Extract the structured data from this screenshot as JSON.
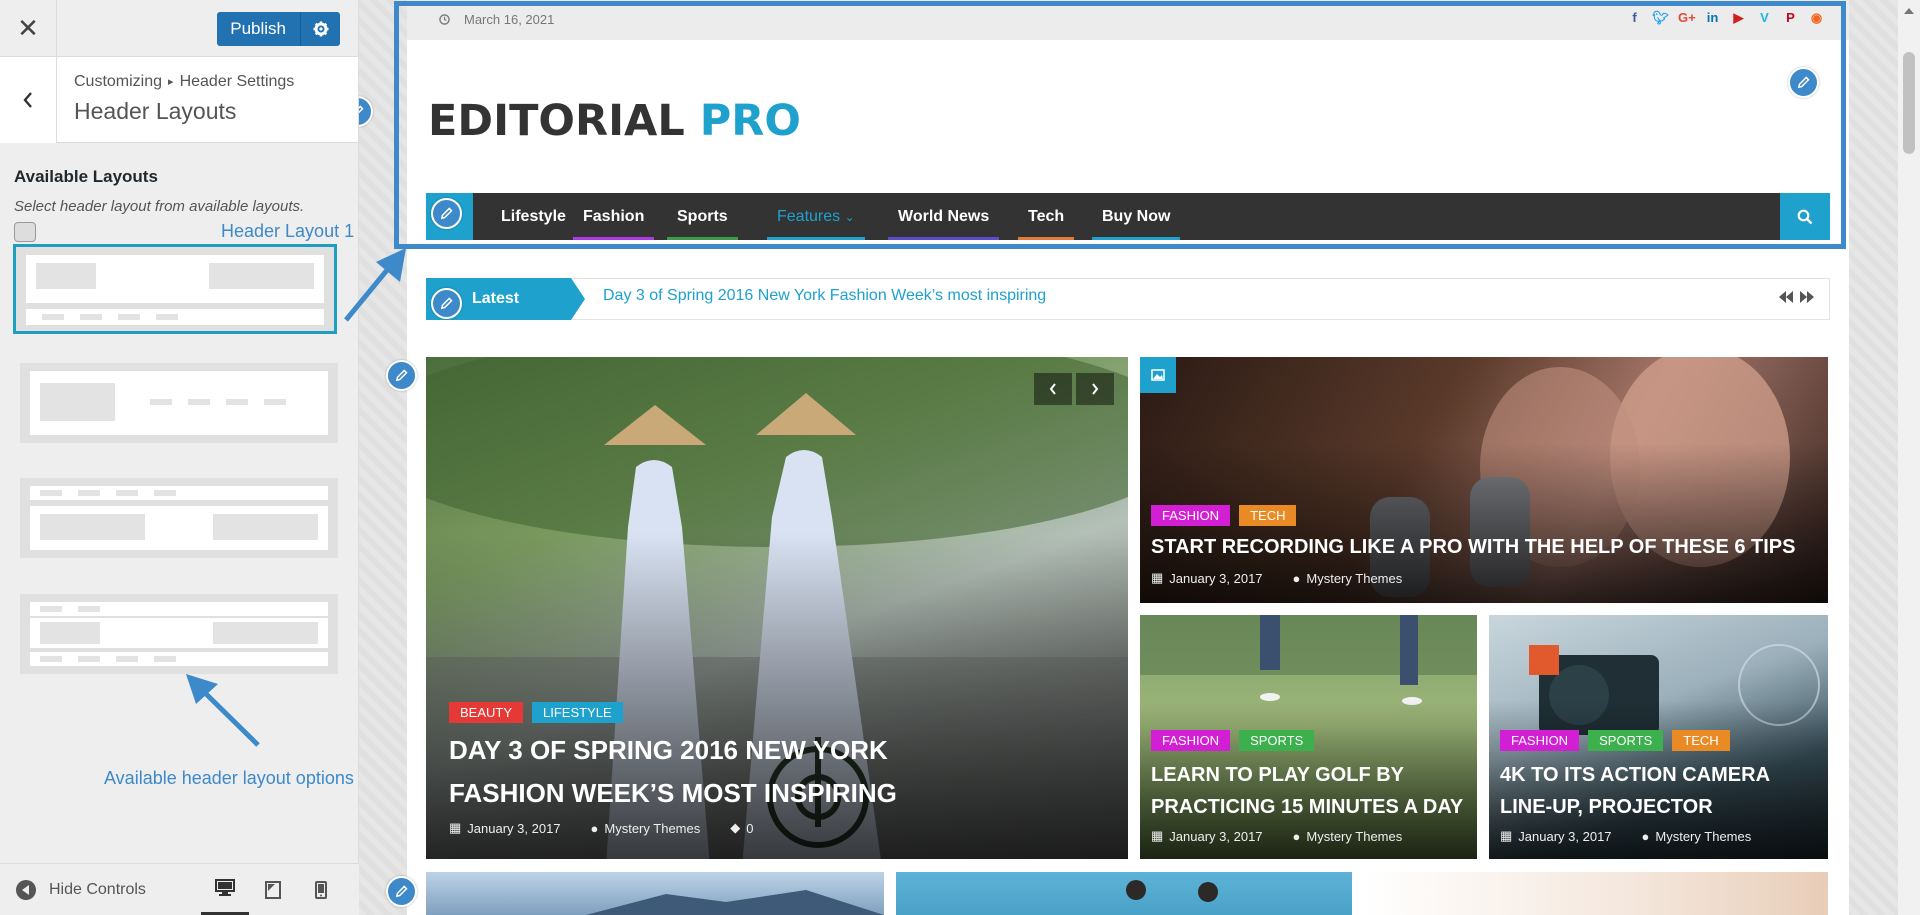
{
  "customizer": {
    "publish_label": "Publish",
    "breadcrumb_root": "Customizing",
    "breadcrumb_sep": "▸",
    "breadcrumb_section": "Header Settings",
    "section_title": "Header Layouts",
    "control_title": "Available Layouts",
    "control_desc": "Select header layout from available layouts.",
    "callout_selected": "Header Layout 1",
    "callout_options": "Available header layout options",
    "hide_controls": "Hide Controls",
    "colors": {
      "primary": "#2271b1",
      "accent": "#3d89c9",
      "selected_outline": "#1e9ec1"
    }
  },
  "site": {
    "date": "March 16, 2021",
    "logo_main": "EDITORIAL",
    "logo_accent": "PRO",
    "social_icons": [
      "facebook-icon",
      "twitter-icon",
      "google-plus-icon",
      "linkedin-icon",
      "youtube-icon",
      "vimeo-icon",
      "pinterest-icon",
      "rss-icon"
    ],
    "nav": [
      {
        "label": "Lifestyle",
        "bar": ""
      },
      {
        "label": "Fashion",
        "bar": "#a83be3"
      },
      {
        "label": "Sports",
        "bar": "#3d9b48"
      },
      {
        "label": "Features",
        "bar": "#1ea1cd",
        "active": true
      },
      {
        "label": "World News",
        "bar": "#5b4ec9"
      },
      {
        "label": "Tech",
        "bar": "#e07b39"
      },
      {
        "label": "Buy Now",
        "bar": "#1ea1cd"
      }
    ],
    "ticker_label": "Latest",
    "ticker_text": "Day 3 of Spring 2016 New York Fashion Week’s most inspiring",
    "colors": {
      "brand": "#1ea1cd",
      "nav_bg": "#333333"
    },
    "posts": {
      "main": {
        "cats": [
          "BEAUTY",
          "LIFESTYLE"
        ],
        "title": "DAY 3 OF SPRING 2016 NEW YORK FASHION WEEK’S MOST INSPIRING",
        "date": "January 3, 2017",
        "author": "Mystery Themes",
        "comments": "0"
      },
      "top_right": {
        "cats": [
          "FASHION",
          "TECH"
        ],
        "title": "START RECORDING LIKE A PRO WITH THE HELP OF THESE 6 TIPS",
        "date": "January 3, 2017",
        "author": "Mystery Themes"
      },
      "bottom_left": {
        "cats": [
          "FASHION",
          "SPORTS"
        ],
        "title": "LEARN TO PLAY GOLF BY PRACTICING 15 MINUTES A DAY",
        "date": "January 3, 2017",
        "author": "Mystery Themes"
      },
      "bottom_right": {
        "cats": [
          "FASHION",
          "SPORTS",
          "TECH"
        ],
        "title": "4K TO ITS ACTION CAMERA LINE-UP, PROJECTOR",
        "date": "January 3, 2017",
        "author": "Mystery Themes"
      }
    },
    "cat_colors": {
      "BEAUTY": "#e53935",
      "LIFESTYLE": "#1ea1cd",
      "FASHION": "#d21fd3",
      "TECH": "#e98a25",
      "SPORTS": "#3cb04d"
    }
  }
}
